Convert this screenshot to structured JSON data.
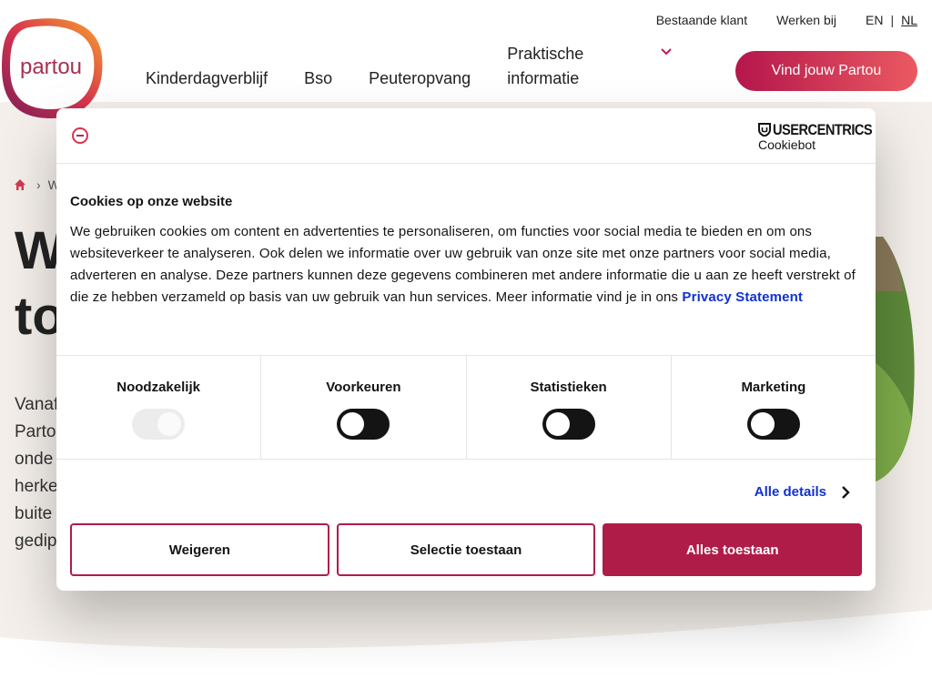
{
  "header": {
    "logo_text": "partou",
    "utility_links": [
      "Bestaande klant",
      "Werken bij"
    ],
    "languages": [
      "EN",
      "NL"
    ],
    "active_language": "NL",
    "nav": [
      "Kinderdagverblijf",
      "Bso",
      "Peuteropvang",
      "Praktische informatie"
    ],
    "cta_label": "Vind jouw Partou"
  },
  "page": {
    "breadcrumb_partial": "W",
    "hero_title_partial": [
      "W",
      "to"
    ],
    "hero_text_partial": [
      "Vanaf",
      "Parto",
      "onde",
      "herke",
      "buite",
      "gedip"
    ]
  },
  "cookie_dialog": {
    "brand_name": "USERCENTRICS",
    "brand_sub": "Cookiebot",
    "title": "Cookies op onze website",
    "body": "We gebruiken cookies om content en advertenties te personaliseren, om functies voor social media te bieden en om ons websiteverkeer te analyseren. Ook delen we informatie over uw gebruik van onze site met onze partners voor social media, adverteren en analyse. Deze partners kunnen deze gegevens combineren met andere informatie die u aan ze heeft verstrekt of die ze hebben verzameld op basis van uw gebruik van hun services. Meer informatie vind je in ons",
    "privacy_link": "Privacy Statement",
    "categories": [
      {
        "label": "Noodzakelijk",
        "checked": true,
        "disabled": true
      },
      {
        "label": "Voorkeuren",
        "checked": false,
        "disabled": false
      },
      {
        "label": "Statistieken",
        "checked": false,
        "disabled": false
      },
      {
        "label": "Marketing",
        "checked": false,
        "disabled": false
      }
    ],
    "details_link": "Alle details",
    "buttons": {
      "decline": "Weigeren",
      "allow_selection": "Selectie toestaan",
      "allow_all": "Alles toestaan"
    }
  },
  "colors": {
    "brand": "#b01c48",
    "link": "#1032cf",
    "cta_gradient_start": "#b5164c",
    "cta_gradient_end": "#ea5a62",
    "page_background": "#f4efea"
  }
}
